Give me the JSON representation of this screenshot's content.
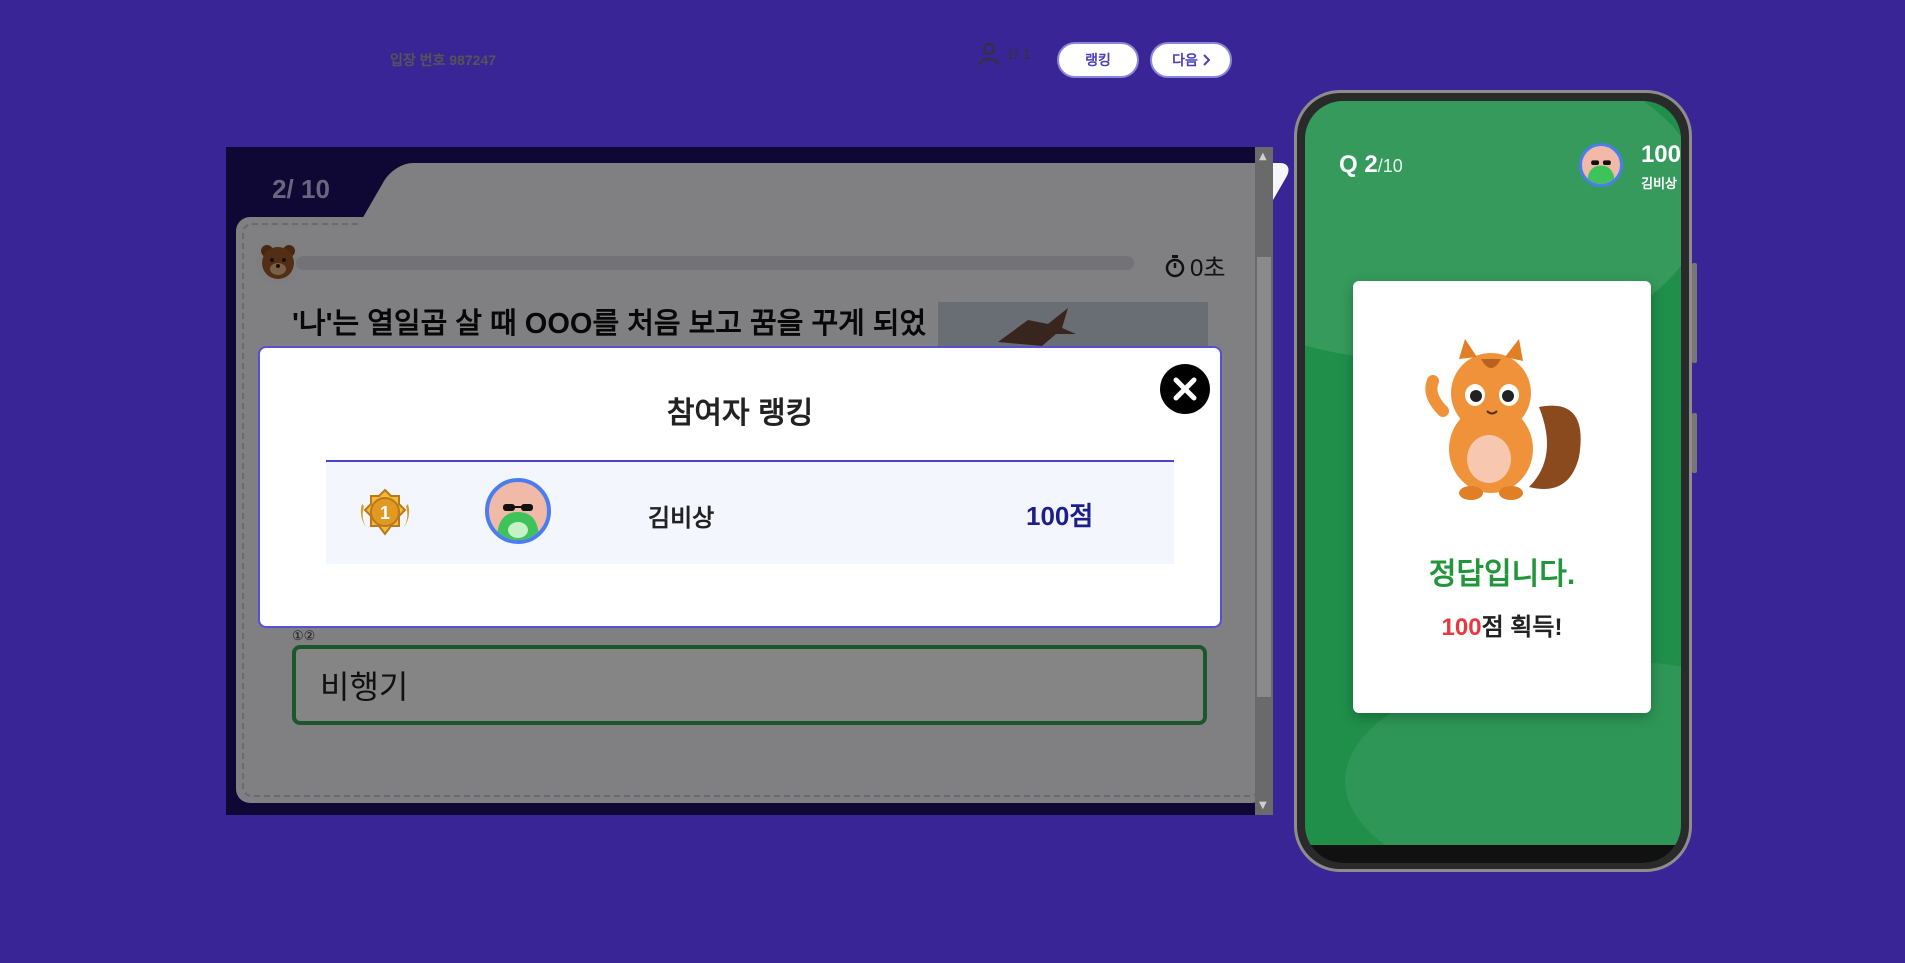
{
  "host": {
    "question_count": "2/ 10",
    "entry_label": "입장 번호 987247",
    "participants": "1/ 1",
    "ranking_button": "랭킹",
    "next_button": "다음",
    "timer": "0초",
    "question_text": "'나'는 열일곱 살 때 OOO를 처음 보고 꿈을 꾸게 되었",
    "choice_numbers": "①②",
    "answer": "비행기"
  },
  "modal": {
    "title": "참여자 랭킹",
    "rows": [
      {
        "rank": "1",
        "name": "김비상",
        "score": "100점"
      }
    ]
  },
  "phone": {
    "q_current": "Q 2",
    "q_total": "/10",
    "score": "100",
    "name": "김비상",
    "result_text": "정답입니다.",
    "earned_points": "100",
    "earned_suffix": "점 획득!"
  },
  "colors": {
    "background": "#3a2596",
    "accent": "#4a42c9",
    "correct_green": "#22963a",
    "points_red": "#e8383d",
    "phone_bg": "#1f8f4a"
  }
}
